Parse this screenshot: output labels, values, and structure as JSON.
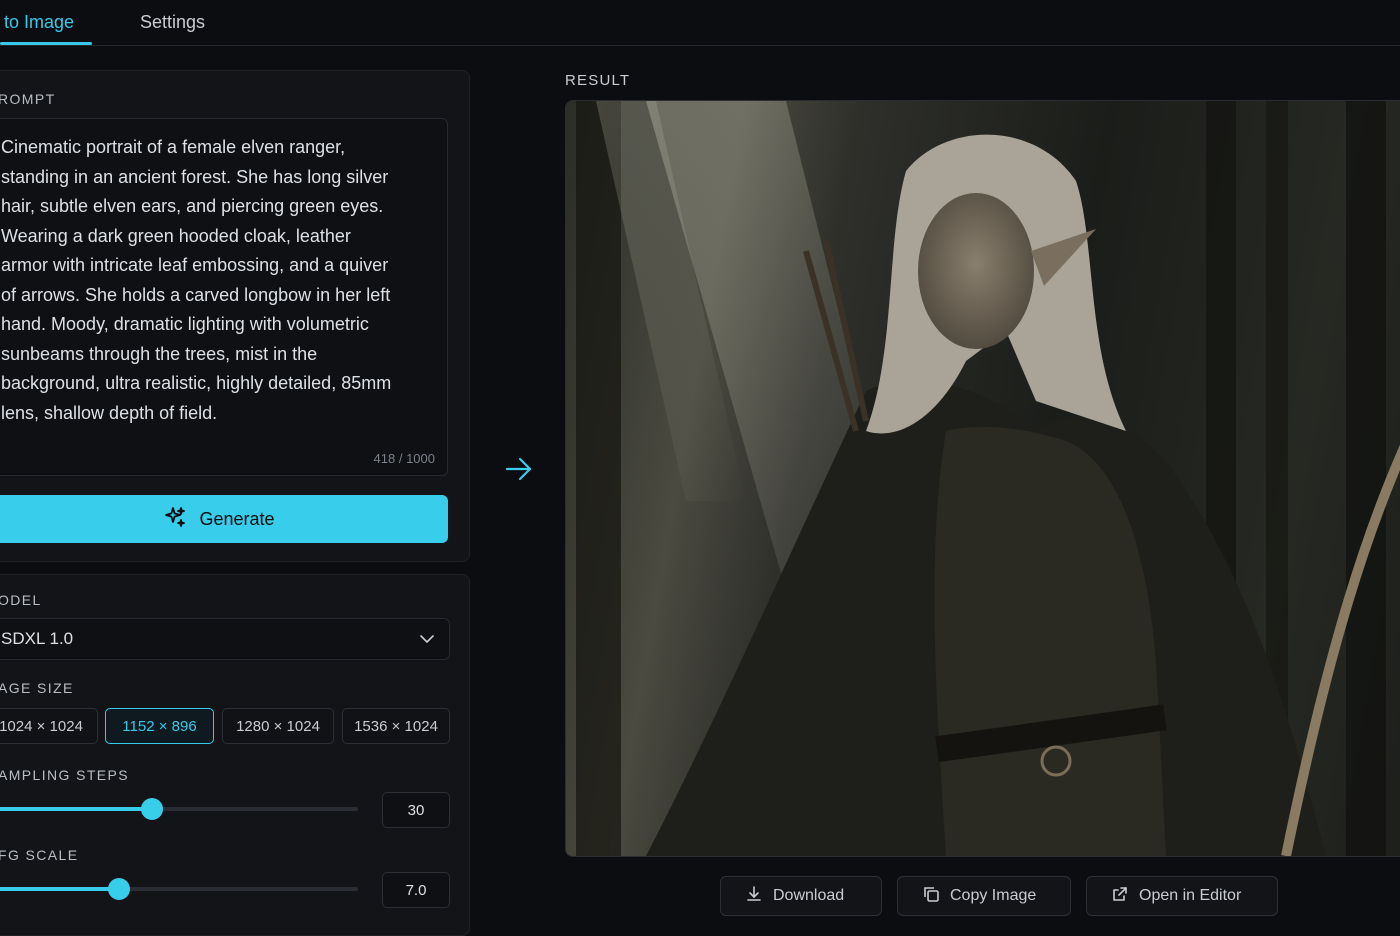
{
  "tabs": [
    {
      "label": "t to Image",
      "active": true
    },
    {
      "label": "Settings",
      "active": false
    }
  ],
  "prompt": {
    "label": "ROMPT",
    "text": "Cinematic portrait of a female elven ranger, standing in an ancient forest. She has long silver hair, subtle elven ears, and piercing green eyes. Wearing a dark green hooded cloak, leather armor with intricate leaf embossing, and a quiver of arrows. She holds a carved longbow in her left hand. Moody, dramatic lighting with volumetric sunbeams through the trees, mist in the background, ultra realistic, highly detailed, 85mm lens, shallow depth of field.",
    "char_count": "418 / 1000"
  },
  "generate_button": {
    "label": "Generate",
    "icon": "sparkles-icon"
  },
  "model": {
    "label": "ODEL",
    "selected": "SDXL 1.0"
  },
  "image_size": {
    "label": "AGE SIZE",
    "options": [
      "1024 × 1024",
      "1152 × 896",
      "1280 × 1024",
      "1536 × 1024"
    ],
    "selected": "1152 × 896"
  },
  "sampling_steps": {
    "label": "AMPLING STEPS",
    "value": "30",
    "fraction": 0.44
  },
  "cfg_scale": {
    "label": "FG SCALE",
    "value": "7.0",
    "fraction": 0.35
  },
  "result": {
    "label": "RESULT",
    "image": "elven-ranger-portrait"
  },
  "actions": [
    {
      "label": "Download",
      "icon": "download-icon"
    },
    {
      "label": "Copy Image",
      "icon": "copy-icon"
    },
    {
      "label": "Open in Editor",
      "icon": "external-link-icon"
    }
  ],
  "colors": {
    "accent": "#38cdea",
    "background": "#0c0d10",
    "panel": "#121418"
  }
}
